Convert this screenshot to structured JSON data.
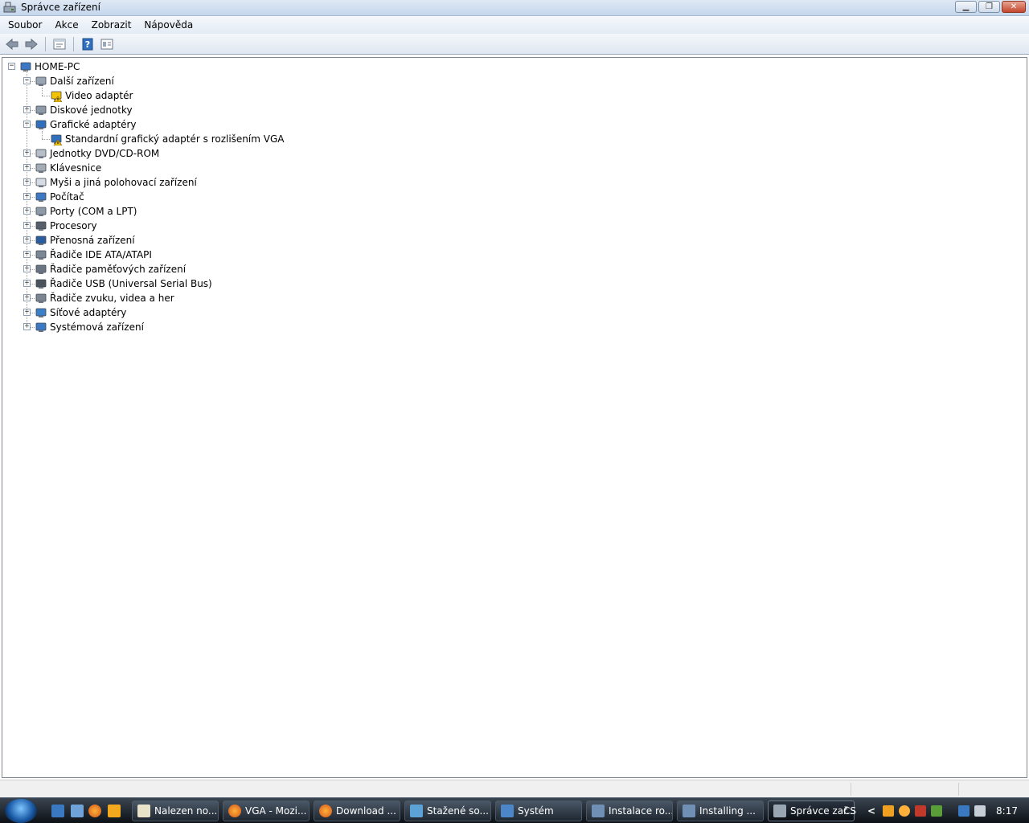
{
  "window": {
    "title": "Správce zařízení",
    "controls": {
      "minimize": "▁",
      "restore": "❐",
      "close": "✕"
    }
  },
  "menu": [
    "Soubor",
    "Akce",
    "Zobrazit",
    "Nápověda"
  ],
  "toolbar": {
    "buttons": [
      "back-arrow-icon",
      "forward-arrow-icon",
      "properties-icon",
      "help-icon",
      "view-icon"
    ]
  },
  "tree": {
    "root": "HOME-PC",
    "items": [
      {
        "label": "Další zařízení",
        "expanded": true,
        "icon": "unknown-device-icon",
        "children": [
          {
            "label": "Video adaptér",
            "icon": "warning-device-icon"
          }
        ]
      },
      {
        "label": "Diskové jednotky",
        "expanded": false,
        "icon": "disk-icon"
      },
      {
        "label": "Grafické adaptéry",
        "expanded": true,
        "icon": "display-adapter-icon",
        "children": [
          {
            "label": "Standardní grafický adaptér s rozlišením VGA",
            "icon": "warning-display-icon"
          }
        ]
      },
      {
        "label": "Jednotky DVD/CD-ROM",
        "expanded": false,
        "icon": "dvd-icon"
      },
      {
        "label": "Klávesnice",
        "expanded": false,
        "icon": "keyboard-icon"
      },
      {
        "label": "Myši a jiná polohovací zařízení",
        "expanded": false,
        "icon": "mouse-icon"
      },
      {
        "label": "Počítač",
        "expanded": false,
        "icon": "computer-icon"
      },
      {
        "label": "Porty (COM a LPT)",
        "expanded": false,
        "icon": "port-icon"
      },
      {
        "label": "Procesory",
        "expanded": false,
        "icon": "cpu-icon"
      },
      {
        "label": "Přenosná zařízení",
        "expanded": false,
        "icon": "portable-device-icon"
      },
      {
        "label": "Řadiče IDE ATA/ATAPI",
        "expanded": false,
        "icon": "ide-controller-icon"
      },
      {
        "label": "Řadiče paměťových zařízení",
        "expanded": false,
        "icon": "storage-controller-icon"
      },
      {
        "label": "Řadiče USB (Universal Serial Bus)",
        "expanded": false,
        "icon": "usb-icon"
      },
      {
        "label": "Řadiče zvuku, videa a her",
        "expanded": false,
        "icon": "sound-icon"
      },
      {
        "label": "Síťové adaptéry",
        "expanded": false,
        "icon": "network-icon"
      },
      {
        "label": "Systémová zařízení",
        "expanded": false,
        "icon": "system-device-icon"
      }
    ]
  },
  "taskbar": {
    "tasks": [
      {
        "label": "Nalezen no...",
        "icon": "found-hardware-icon"
      },
      {
        "label": "VGA - Mozi...",
        "icon": "firefox-icon"
      },
      {
        "label": "Download ...",
        "icon": "firefox-icon"
      },
      {
        "label": "Stažené so...",
        "icon": "folder-icon"
      },
      {
        "label": "Systém",
        "icon": "system-icon"
      },
      {
        "label": "Instalace ro...",
        "icon": "installer-icon"
      },
      {
        "label": "Installing ...",
        "icon": "installer-icon"
      },
      {
        "label": "Správce zař...",
        "icon": "device-manager-icon",
        "active": true
      }
    ],
    "tray": {
      "language": "CS",
      "time": "8:17",
      "chevron": "<"
    }
  },
  "colors": {
    "accent": "#1a5aa6",
    "warning": "#f5c400"
  }
}
